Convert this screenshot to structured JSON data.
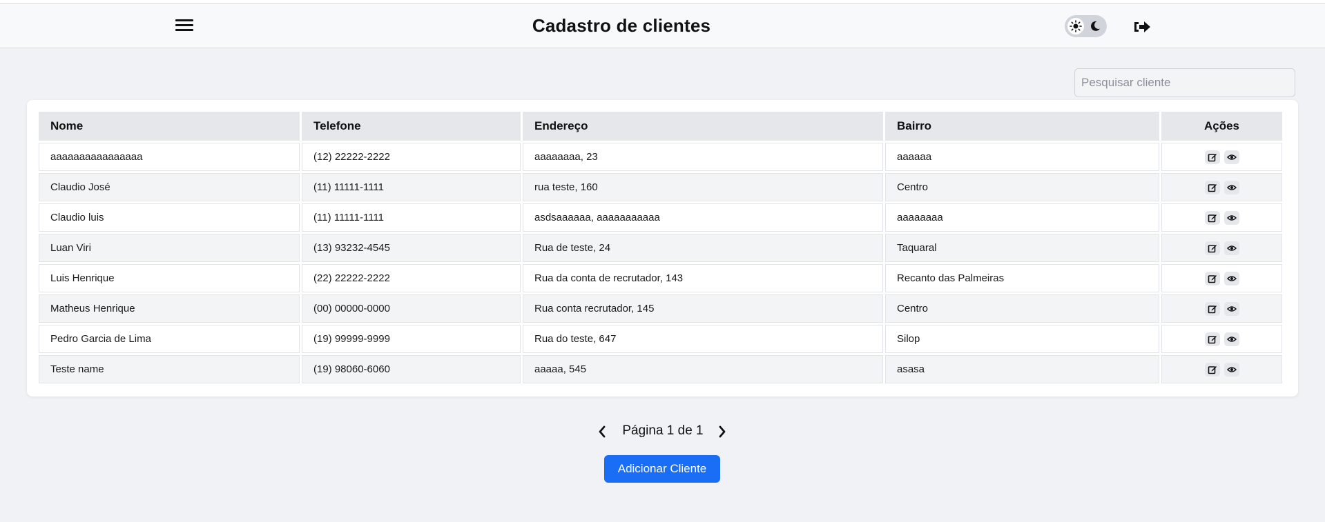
{
  "header": {
    "title": "Cadastro de clientes",
    "menu_icon": "hamburger-menu-icon",
    "theme_icons": [
      "sun-icon",
      "moon-icon"
    ],
    "logout_icon": "logout-icon"
  },
  "search": {
    "placeholder": "Pesquisar cliente",
    "value": ""
  },
  "table": {
    "columns": [
      "Nome",
      "Telefone",
      "Endereço",
      "Bairro",
      "Ações"
    ],
    "rows": [
      {
        "nome": "aaaaaaaaaaaaaaaa",
        "telefone": "(12) 22222-2222",
        "endereco": "aaaaaaaa, 23",
        "bairro": "aaaaaa"
      },
      {
        "nome": "Claudio José",
        "telefone": "(11) 11111-1111",
        "endereco": "rua teste, 160",
        "bairro": "Centro"
      },
      {
        "nome": "Claudio luis",
        "telefone": "(11) 11111-1111",
        "endereco": "asdsaaaaaa, aaaaaaaaaaa",
        "bairro": "aaaaaaaa"
      },
      {
        "nome": "Luan Viri",
        "telefone": "(13) 93232-4545",
        "endereco": "Rua de teste, 24",
        "bairro": "Taquaral"
      },
      {
        "nome": "Luis Henrique",
        "telefone": "(22) 22222-2222",
        "endereco": "Rua da conta de recrutador, 143",
        "bairro": "Recanto das Palmeiras"
      },
      {
        "nome": "Matheus Henrique",
        "telefone": "(00) 00000-0000",
        "endereco": "Rua conta recrutador, 145",
        "bairro": "Centro"
      },
      {
        "nome": "Pedro Garcia de Lima",
        "telefone": "(19) 99999-9999",
        "endereco": "Rua do teste, 647",
        "bairro": "Silop"
      },
      {
        "nome": "Teste name",
        "telefone": "(19) 98060-6060",
        "endereco": "aaaaa, 545",
        "bairro": "asasa"
      }
    ],
    "row_action_icons": [
      "edit-icon",
      "view-eye-icon"
    ]
  },
  "pagination": {
    "label": "Página 1 de 1",
    "current": 1,
    "total": 1
  },
  "add_button": {
    "label": "Adicionar Cliente"
  },
  "colors": {
    "accent": "#1a6ef5",
    "background": "#f0f2f5",
    "header_bg": "#f8f9fb",
    "table_header_bg": "#e6e7ea"
  }
}
